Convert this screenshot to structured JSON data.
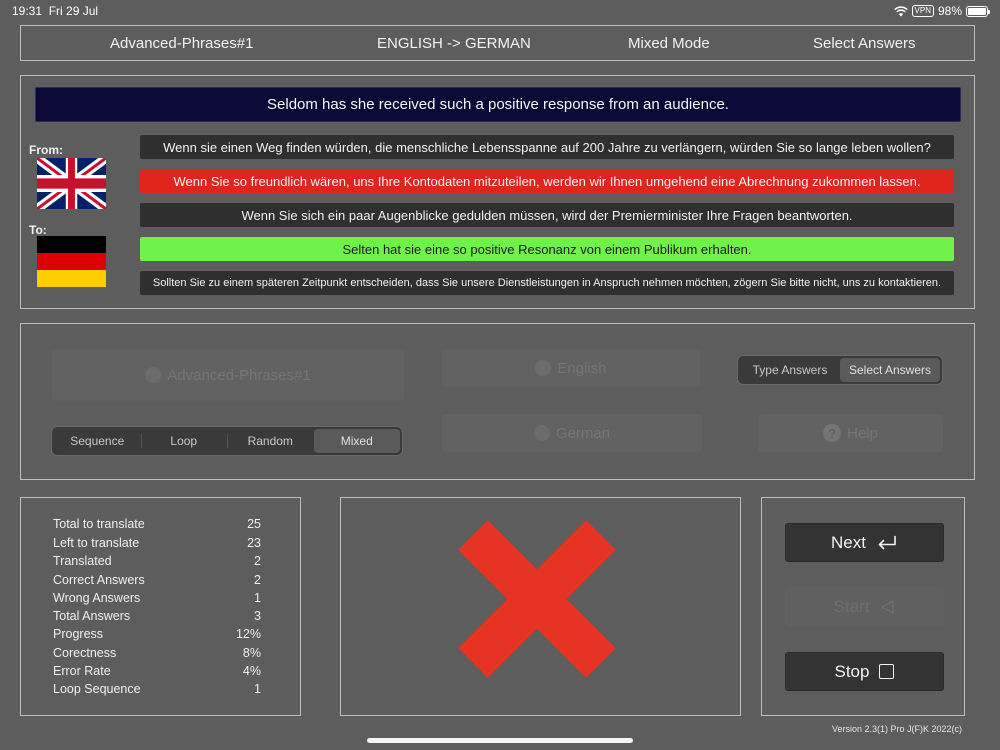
{
  "status_bar": {
    "time": "19:31",
    "date": "Fri 29 Jul",
    "vpn": "VPN",
    "battery": "98%",
    "battery_level": 0.98
  },
  "header": {
    "lesson": "Advanced-Phrases#1",
    "direction": "ENGLISH -> GERMAN",
    "mode": "Mixed Mode",
    "answer_mode": "Select Answers"
  },
  "question": {
    "sentence": "Seldom has she received such a positive response from an audience.",
    "from_label": "From:",
    "to_label": "To:",
    "from_flag": "uk-flag",
    "to_flag": "germany-flag",
    "answers": [
      {
        "text": "Wenn sie einen Weg finden würden, die menschliche Lebensspanne auf 200 Jahre zu verlängern, würden Sie so lange leben wollen?",
        "state": "neutral"
      },
      {
        "text": "Wenn Sie so freundlich wären, uns Ihre Kontodaten mitzuteilen, werden wir Ihnen umgehend eine Abrechnung zukommen lassen.",
        "state": "wrong"
      },
      {
        "text": "Wenn Sie sich ein paar Augenblicke gedulden müssen, wird der Premierminister Ihre Fragen beantworten.",
        "state": "neutral"
      },
      {
        "text": "Selten hat sie eine so positive Resonanz von einem Publikum erhalten.",
        "state": "correct"
      },
      {
        "text": "Sollten Sie zu einem späteren Zeitpunkt entscheiden, dass Sie unsere Dienstleistungen in Anspruch nehmen möchten, zögern Sie bitte nicht, uns zu kontaktieren.",
        "state": "neutral"
      }
    ],
    "colors": {
      "wrong": "#e0251c",
      "correct": "#6ff24a",
      "neutral": "#2f2f2f",
      "sentence_bg": "#0b0a36"
    }
  },
  "settings": {
    "lesson_button": "Advanced-Phrases#1",
    "from_language_button": "English",
    "to_language_button": "German",
    "help_button": "Help",
    "answer_type": {
      "options": [
        "Type Answers",
        "Select Answers"
      ],
      "selected": "Select Answers"
    },
    "order": {
      "options": [
        "Sequence",
        "Loop",
        "Random",
        "Mixed"
      ],
      "selected": "Mixed"
    }
  },
  "stats": [
    {
      "label": "Total to translate",
      "value": "25"
    },
    {
      "label": "Left to translate",
      "value": "23"
    },
    {
      "label": "Translated",
      "value": "2"
    },
    {
      "label": "Correct Answers",
      "value": "2"
    },
    {
      "label": "Wrong Answers",
      "value": "1"
    },
    {
      "label": "Total Answers",
      "value": "3"
    },
    {
      "label": "Progress",
      "value": "12%"
    },
    {
      "label": "Corectness",
      "value": "8%"
    },
    {
      "label": "Error Rate",
      "value": "4%"
    },
    {
      "label": "Loop Sequence",
      "value": "1"
    }
  ],
  "result": {
    "icon": "wrong-cross-icon",
    "color": "#e63323"
  },
  "actions": {
    "next": "Next",
    "start": "Start",
    "stop": "Stop"
  },
  "footer": {
    "version": "Version 2.3(1) Pro J(F)K 2022(c)"
  }
}
